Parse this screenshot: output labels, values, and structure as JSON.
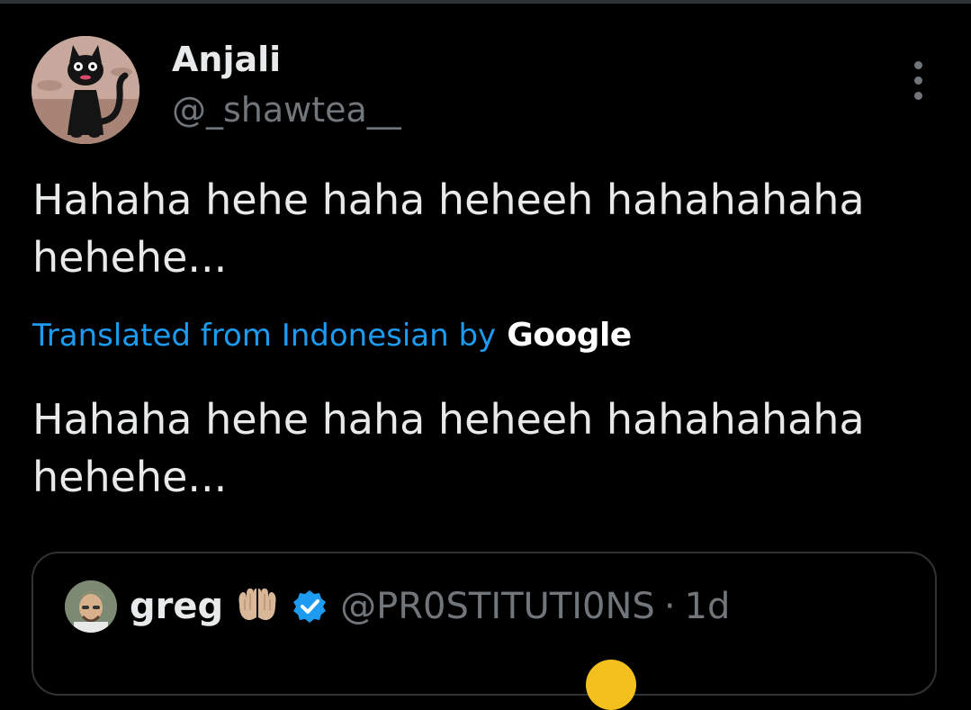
{
  "tweet": {
    "author": {
      "display_name": "Anjali",
      "handle": "@_shawtea__"
    },
    "text": "Hahaha hehe haha heheeh hahahahaha hehehe...",
    "translation": {
      "label": "Translated from Indonesian by",
      "provider": "Google",
      "text": "Hahaha hehe haha heheeh hahahahaha hehehe..."
    }
  },
  "quote": {
    "display_name": "greg",
    "handle": "@PR0STITUTI0NS",
    "separator": "·",
    "time": "1d"
  },
  "colors": {
    "background": "#000000",
    "text_primary": "#e7e9ea",
    "text_secondary": "#71767b",
    "link": "#1d9bf0",
    "border": "#2f3336",
    "verified": "#1d9bf0"
  },
  "icons": {
    "more": "more-vertical-icon",
    "verified": "verified-badge-icon",
    "hands": "palms-up-together-icon"
  }
}
